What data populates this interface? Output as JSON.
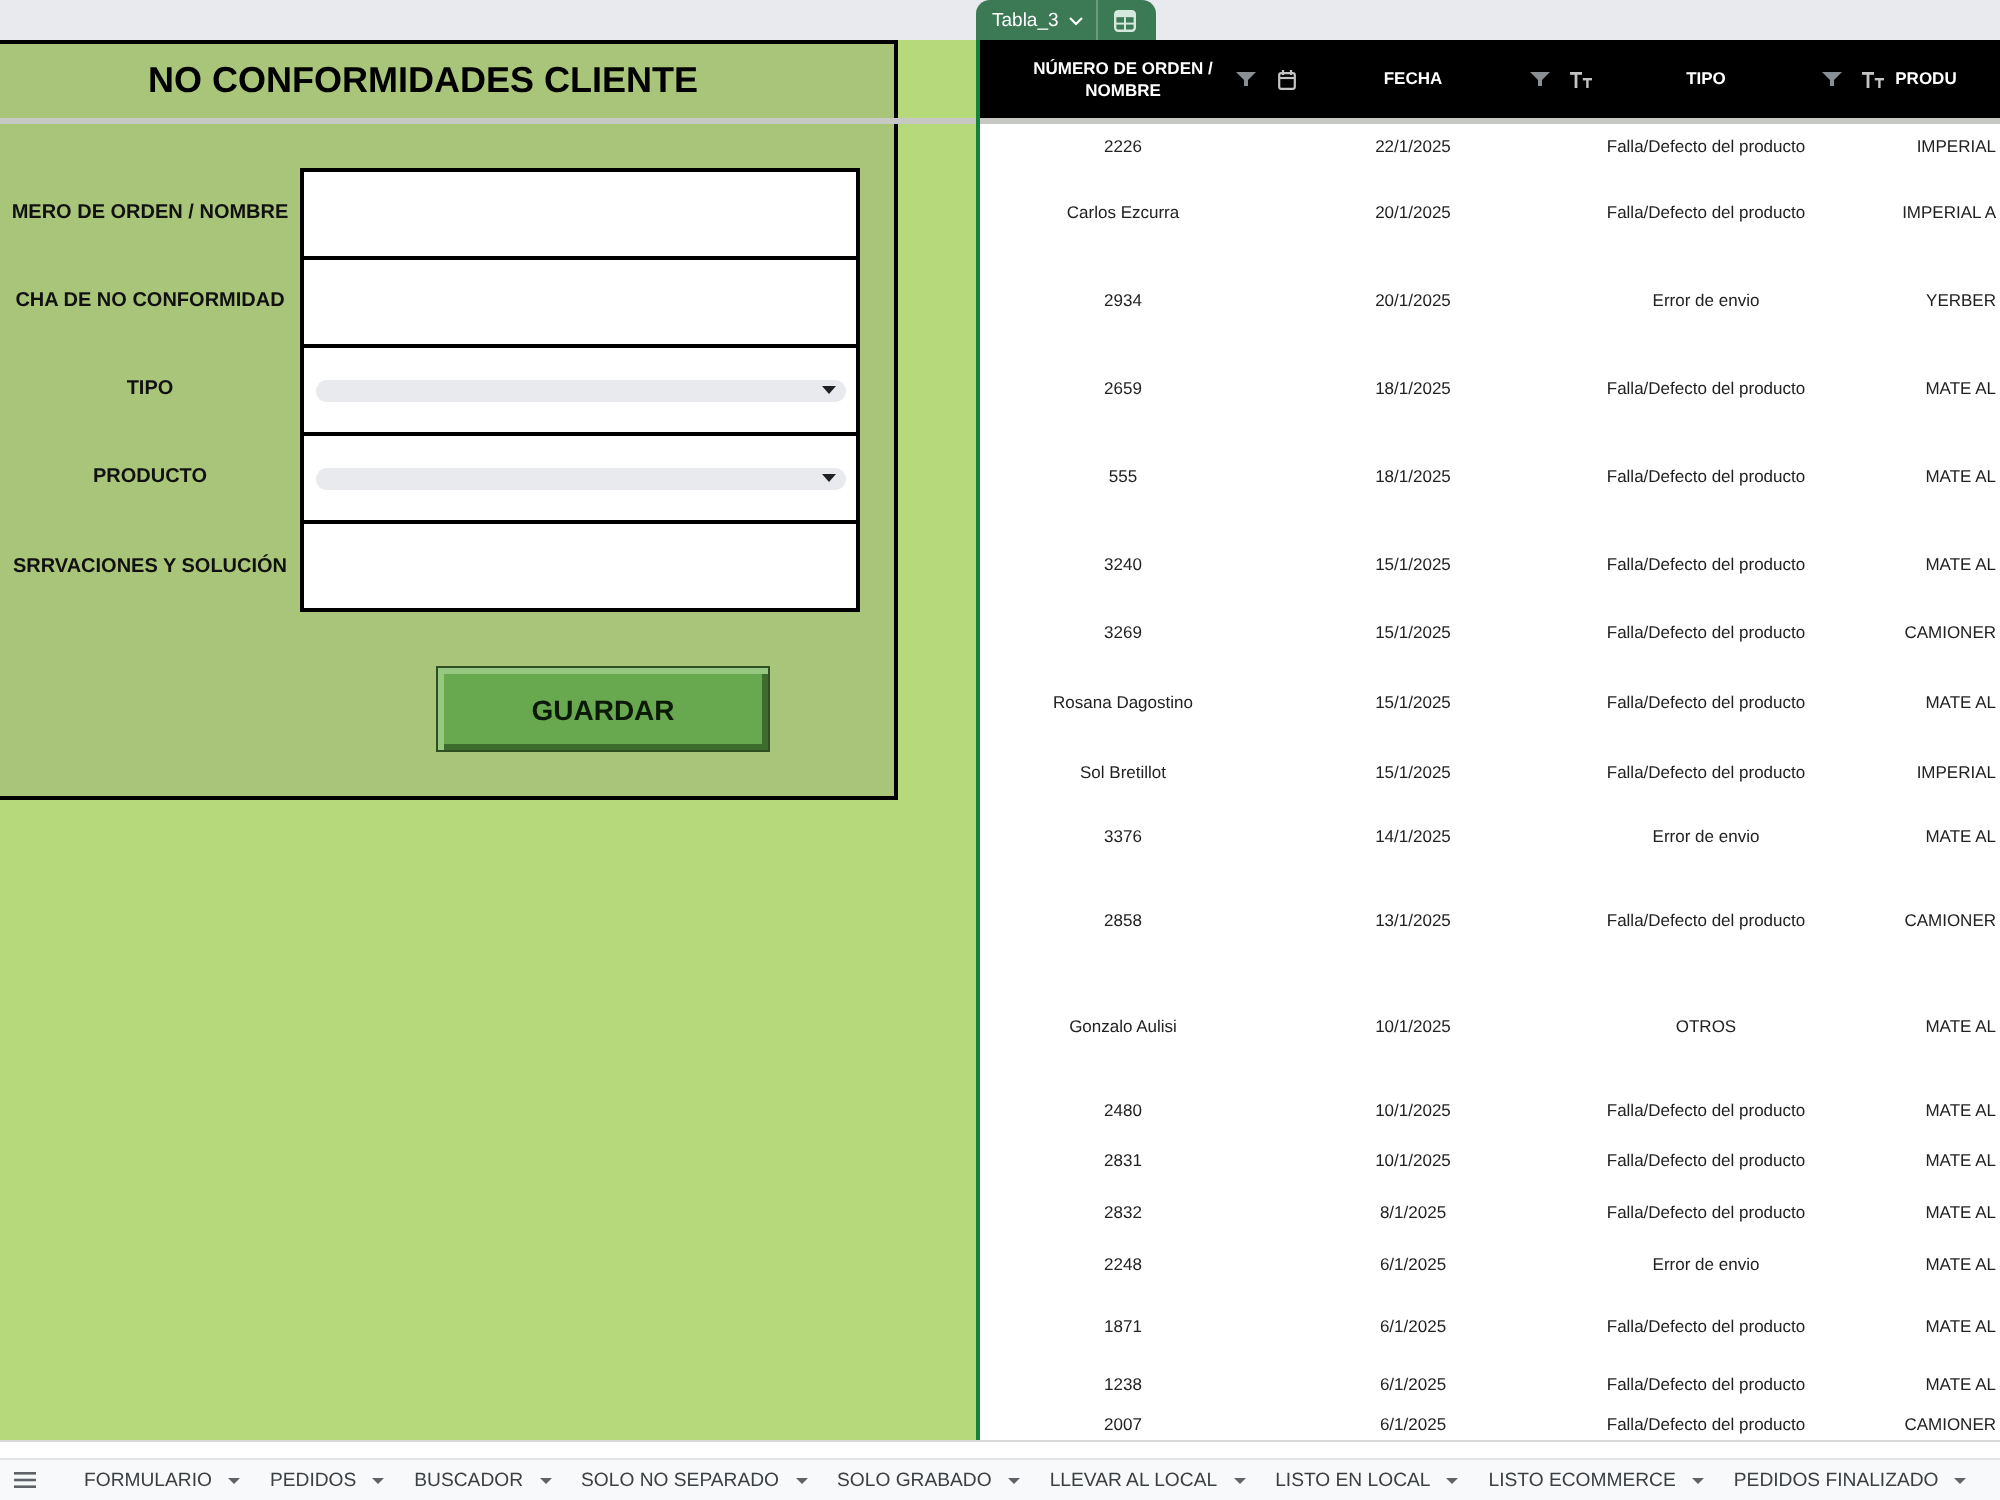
{
  "top_bar": {
    "table_tab": {
      "label": "Tabla_3"
    }
  },
  "form": {
    "title": "NO CONFORMIDADES CLIENTE",
    "fields": [
      {
        "label": "MERO DE ORDEN / NOMBRE",
        "kind": "text"
      },
      {
        "label": "CHA DE NO CONFORMIDAD",
        "kind": "text"
      },
      {
        "label": "TIPO",
        "kind": "dropdown"
      },
      {
        "label": "PRODUCTO",
        "kind": "dropdown"
      },
      {
        "label": "SRRVACIONES Y SOLUCIÓN",
        "kind": "text"
      }
    ],
    "button": {
      "label": "GUARDAR"
    }
  },
  "table": {
    "columns": [
      {
        "label": "NÚMERO DE ORDEN / NOMBRE",
        "kind": "plain",
        "filter": true
      },
      {
        "label": "FECHA",
        "kind": "date",
        "filter": true
      },
      {
        "label": "TIPO",
        "kind": "text",
        "filter": true
      },
      {
        "label": "PRODU",
        "kind": "text",
        "filter": false
      }
    ],
    "rows": [
      [
        "2226",
        "22/1/2025",
        "Falla/Defecto del producto",
        "IMPERIAL"
      ],
      [
        "Carlos Ezcurra",
        "20/1/2025",
        "Falla/Defecto del producto",
        "IMPERIAL A"
      ],
      [
        "2934",
        "20/1/2025",
        "Error de envio",
        "YERBER"
      ],
      [
        "2659",
        "18/1/2025",
        "Falla/Defecto del producto",
        "MATE AL"
      ],
      [
        "555",
        "18/1/2025",
        "Falla/Defecto del producto",
        "MATE AL"
      ],
      [
        "3240",
        "15/1/2025",
        "Falla/Defecto del producto",
        "MATE AL"
      ],
      [
        "3269",
        "15/1/2025",
        "Falla/Defecto del producto",
        "CAMIONER"
      ],
      [
        "Rosana Dagostino",
        "15/1/2025",
        "Falla/Defecto del producto",
        "MATE AL"
      ],
      [
        "Sol Bretillot",
        "15/1/2025",
        "Falla/Defecto del producto",
        "IMPERIAL"
      ],
      [
        "3376",
        "14/1/2025",
        "Error de envio",
        "MATE AL"
      ],
      [
        "2858",
        "13/1/2025",
        "Falla/Defecto del producto",
        "CAMIONER"
      ],
      [
        "Gonzalo Aulisi",
        "10/1/2025",
        "OTROS",
        "MATE AL"
      ],
      [
        "2480",
        "10/1/2025",
        "Falla/Defecto del producto",
        "MATE AL"
      ],
      [
        "2831",
        "10/1/2025",
        "Falla/Defecto del producto",
        "MATE AL"
      ],
      [
        "2832",
        "8/1/2025",
        "Falla/Defecto del producto",
        "MATE AL"
      ],
      [
        "2248",
        "6/1/2025",
        "Error de envio",
        "MATE AL"
      ],
      [
        "1871",
        "6/1/2025",
        "Falla/Defecto del producto",
        "MATE AL"
      ],
      [
        "1238",
        "6/1/2025",
        "Falla/Defecto del producto",
        "MATE AL"
      ],
      [
        "2007",
        "6/1/2025",
        "Falla/Defecto del producto",
        "CAMIONER"
      ]
    ]
  },
  "sheet_tabs": [
    {
      "label": "FORMULARIO",
      "selected": false
    },
    {
      "label": "PEDIDOS",
      "selected": false
    },
    {
      "label": "BUSCADOR",
      "selected": false
    },
    {
      "label": "SOLO NO SEPARADO",
      "selected": false
    },
    {
      "label": "SOLO GRABADO",
      "selected": false
    },
    {
      "label": "LLEVAR AL LOCAL",
      "selected": false
    },
    {
      "label": "LISTO EN LOCAL",
      "selected": false
    },
    {
      "label": "LISTO ECOMMERCE",
      "selected": false
    },
    {
      "label": "PEDIDOS FINALIZADO",
      "selected": false
    }
  ]
}
